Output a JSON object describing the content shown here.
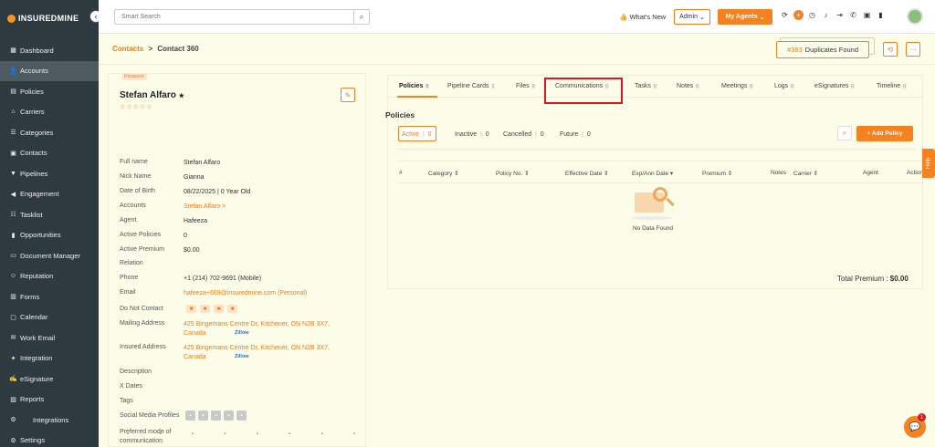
{
  "brand": {
    "name": "INSUREDMINE",
    "accent": "#f58220",
    "sidebar_bg": "#2d3a40",
    "page_bg": "#fbfde9"
  },
  "sidebar": {
    "items": [
      {
        "label": "Dashboard",
        "icon": "grid-icon"
      },
      {
        "label": "Accounts",
        "icon": "person-icon",
        "active": true
      },
      {
        "label": "Policies",
        "icon": "document-icon"
      },
      {
        "label": "Carriers",
        "icon": "bank-icon"
      },
      {
        "label": "Categories",
        "icon": "categories-icon"
      },
      {
        "label": "Contacts",
        "icon": "contacts-icon"
      },
      {
        "label": "Pipelines",
        "icon": "funnel-icon"
      },
      {
        "label": "Engagement",
        "icon": "megaphone-icon"
      },
      {
        "label": "Tasklist",
        "icon": "tasklist-icon"
      },
      {
        "label": "Opportunities",
        "icon": "bar-chart-icon"
      },
      {
        "label": "Document Manager",
        "icon": "folder-icon"
      },
      {
        "label": "Reputation",
        "icon": "reputation-icon"
      },
      {
        "label": "Forms",
        "icon": "forms-icon"
      },
      {
        "label": "Calendar",
        "icon": "calendar-icon"
      },
      {
        "label": "Work Email",
        "icon": "mail-icon"
      },
      {
        "label": "Integration",
        "icon": "integration-icon"
      },
      {
        "label": "eSignature",
        "icon": "signature-icon"
      },
      {
        "label": "Reports",
        "icon": "reports-icon"
      },
      {
        "label": "Integrations",
        "icon": "gears-icon"
      },
      {
        "label": "Settings",
        "icon": "gear-icon"
      }
    ]
  },
  "topbar": {
    "search_placeholder": "Smart Search",
    "whats_new": "What's New",
    "admin": "Admin",
    "my_agents": "My Agents"
  },
  "breadcrumb": {
    "parent": "Contacts",
    "separator": ">",
    "current": "Contact 360"
  },
  "duplicates": {
    "count": "#383",
    "label": "Duplicates Found"
  },
  "contact": {
    "badge": "Prospect",
    "name": "Stefan Alfaro",
    "name_star": "★",
    "rating": "☆☆☆☆☆",
    "fields": [
      {
        "label": "Full name",
        "value": "Stefan Alfaro"
      },
      {
        "label": "Nick Name",
        "value": "Gianna"
      },
      {
        "label": "Date of Birth",
        "value": "08/22/2025 | 0 Year Old"
      },
      {
        "label": "Accounts",
        "value": "Stefan Alfaro >",
        "link": true
      },
      {
        "label": "Agent",
        "value": "Hafeeza"
      },
      {
        "label": "Active Policies",
        "value": "0"
      },
      {
        "label": "Active Premium",
        "value": "$0.00"
      },
      {
        "label": "Relation",
        "value": ""
      },
      {
        "label": "Phone",
        "value": "+1 (214) 702-9691 (Mobile)"
      },
      {
        "label": "Email",
        "value": "hafeeza+669@insuredmine.com  (Personal)",
        "link": true
      },
      {
        "label": "Do Not Contact",
        "value": ""
      },
      {
        "label": "Mailing Address",
        "value": "425 Bingemans Centre Dr, Kitchener, ON N2B 3X7, Canada",
        "link": true,
        "zillow": "Zillow"
      },
      {
        "label": "Insured Address",
        "value": "425 Bingemans Centre Dr, Kitchener, ON N2B 3X7, Canada",
        "link": true,
        "zillow": "Zillow"
      },
      {
        "label": "Description",
        "value": ""
      },
      {
        "label": "X Dates",
        "value": ""
      },
      {
        "label": "Tags",
        "value": ""
      },
      {
        "label": "Social Media Profiles",
        "value": ""
      },
      {
        "label": "Preferred mode of communication",
        "value": ""
      }
    ]
  },
  "tabs": [
    {
      "label": "Policies",
      "count": "0",
      "active": true
    },
    {
      "label": "Pipeline Cards",
      "count": "1"
    },
    {
      "label": "Files",
      "count": "0"
    },
    {
      "label": "Communications",
      "count": "0",
      "highlighted": true
    },
    {
      "label": "Tasks",
      "count": "0"
    },
    {
      "label": "Notes",
      "count": "0"
    },
    {
      "label": "Meetings",
      "count": "0"
    },
    {
      "label": "Logs",
      "count": "0"
    },
    {
      "label": "eSignatures",
      "count": "0"
    },
    {
      "label": "Timeline",
      "count": "0"
    }
  ],
  "policies": {
    "heading": "Policies",
    "filters": [
      {
        "label": "Active",
        "count": "0"
      },
      {
        "label": "Inactive",
        "count": "0"
      },
      {
        "label": "Cancelled",
        "count": "0"
      },
      {
        "label": "Future",
        "count": "0"
      }
    ],
    "add_button": "+ Add Policy",
    "columns": [
      "#",
      "Category ⇕",
      "Policy No. ⇕",
      "Effective Date ⇕",
      "Exp/Ann Date ▾",
      "Premium ⇕",
      "Notes",
      "Carrier ⇕",
      "Agent",
      "Action"
    ],
    "empty_text": "No Data Found",
    "total_label": "Total Premium : ",
    "total_value": "$0.00"
  },
  "help_label": "Help",
  "chat_badge": "1"
}
